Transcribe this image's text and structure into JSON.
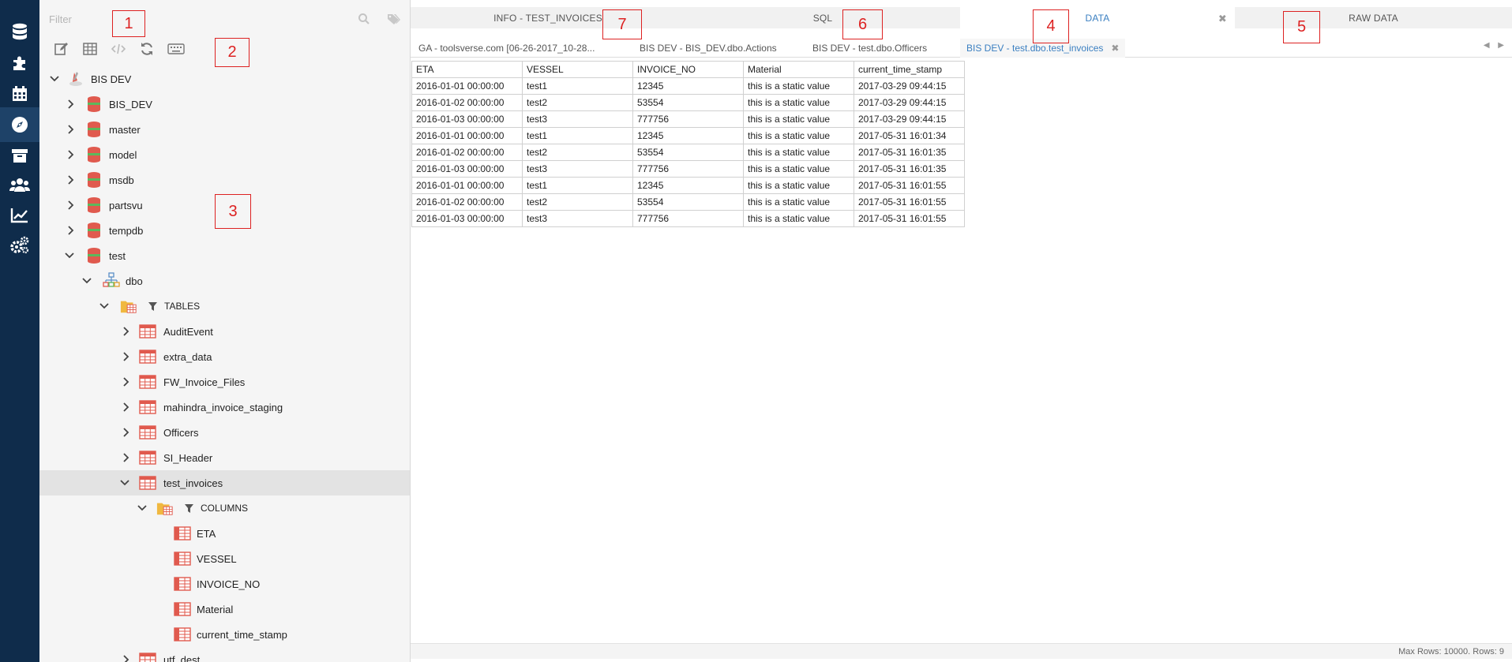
{
  "rail": {
    "items": [
      {
        "name": "database-icon",
        "active": false
      },
      {
        "name": "puzzle-icon",
        "active": false
      },
      {
        "name": "calendar-icon",
        "active": false
      },
      {
        "name": "compass-icon",
        "active": true
      },
      {
        "name": "archive-icon",
        "active": false
      },
      {
        "name": "users-icon",
        "active": false
      },
      {
        "name": "chart-line-icon",
        "active": false
      },
      {
        "name": "gears-icon",
        "active": false
      }
    ]
  },
  "filter": {
    "placeholder": "Filter"
  },
  "toolbar": {
    "buttons": [
      "edit-icon",
      "table-icon",
      "code-icon",
      "refresh-icon",
      "keyboard-icon"
    ]
  },
  "tree": {
    "root": "BIS DEV",
    "databases": [
      "BIS_DEV",
      "master",
      "model",
      "msdb",
      "partsvu",
      "tempdb",
      "test"
    ],
    "schema": "dbo",
    "tables_folder": "TABLES",
    "tables": [
      "AuditEvent",
      "extra_data",
      "FW_Invoice_Files",
      "mahindra_invoice_staging",
      "Officers",
      "SI_Header",
      "test_invoices"
    ],
    "columns_folder": "COLUMNS",
    "columns": [
      "ETA",
      "VESSEL",
      "INVOICE_NO",
      "Material",
      "current_time_stamp"
    ],
    "last_table": "utf_dest"
  },
  "top_tabs": [
    {
      "label": "INFO - TEST_INVOICES",
      "active": false
    },
    {
      "label": "SQL",
      "active": false
    },
    {
      "label": "DATA",
      "active": true,
      "close": "✖"
    },
    {
      "label": "RAW DATA",
      "active": false
    }
  ],
  "doc_tabs": [
    {
      "label": "GA - toolsverse.com [06-26-2017_10-28...",
      "active": false
    },
    {
      "label": "BIS DEV - BIS_DEV.dbo.Actions",
      "active": false
    },
    {
      "label": "BIS DEV - test.dbo.Officers",
      "active": false
    },
    {
      "label": "BIS DEV - test.dbo.test_invoices",
      "active": true,
      "close": "✖"
    }
  ],
  "grid": {
    "columns": [
      "ETA",
      "VESSEL",
      "INVOICE_NO",
      "Material",
      "current_time_stamp"
    ],
    "rows": [
      [
        "2016-01-01 00:00:00",
        "test1",
        "12345",
        "this is a static value",
        "2017-03-29 09:44:15"
      ],
      [
        "2016-01-02 00:00:00",
        "test2",
        "53554",
        "this is a static value",
        "2017-03-29 09:44:15"
      ],
      [
        "2016-01-03 00:00:00",
        "test3",
        "777756",
        "this is a static value",
        "2017-03-29 09:44:15"
      ],
      [
        "2016-01-01 00:00:00",
        "test1",
        "12345",
        "this is a static value",
        "2017-05-31 16:01:34"
      ],
      [
        "2016-01-02 00:00:00",
        "test2",
        "53554",
        "this is a static value",
        "2017-05-31 16:01:35"
      ],
      [
        "2016-01-03 00:00:00",
        "test3",
        "777756",
        "this is a static value",
        "2017-05-31 16:01:35"
      ],
      [
        "2016-01-01 00:00:00",
        "test1",
        "12345",
        "this is a static value",
        "2017-05-31 16:01:55"
      ],
      [
        "2016-01-02 00:00:00",
        "test2",
        "53554",
        "this is a static value",
        "2017-05-31 16:01:55"
      ],
      [
        "2016-01-03 00:00:00",
        "test3",
        "777756",
        "this is a static value",
        "2017-05-31 16:01:55"
      ]
    ]
  },
  "status": {
    "text": "Max Rows: 10000. Rows: 9"
  },
  "callouts": [
    "1",
    "2",
    "3",
    "4",
    "5",
    "6",
    "7"
  ],
  "colors": {
    "rail": "#0f2c4b",
    "accent": "#3a7fc1",
    "callout": "#dd2222",
    "db_icon": "#e05a4e",
    "db_icon_band": "#5cb85c"
  }
}
